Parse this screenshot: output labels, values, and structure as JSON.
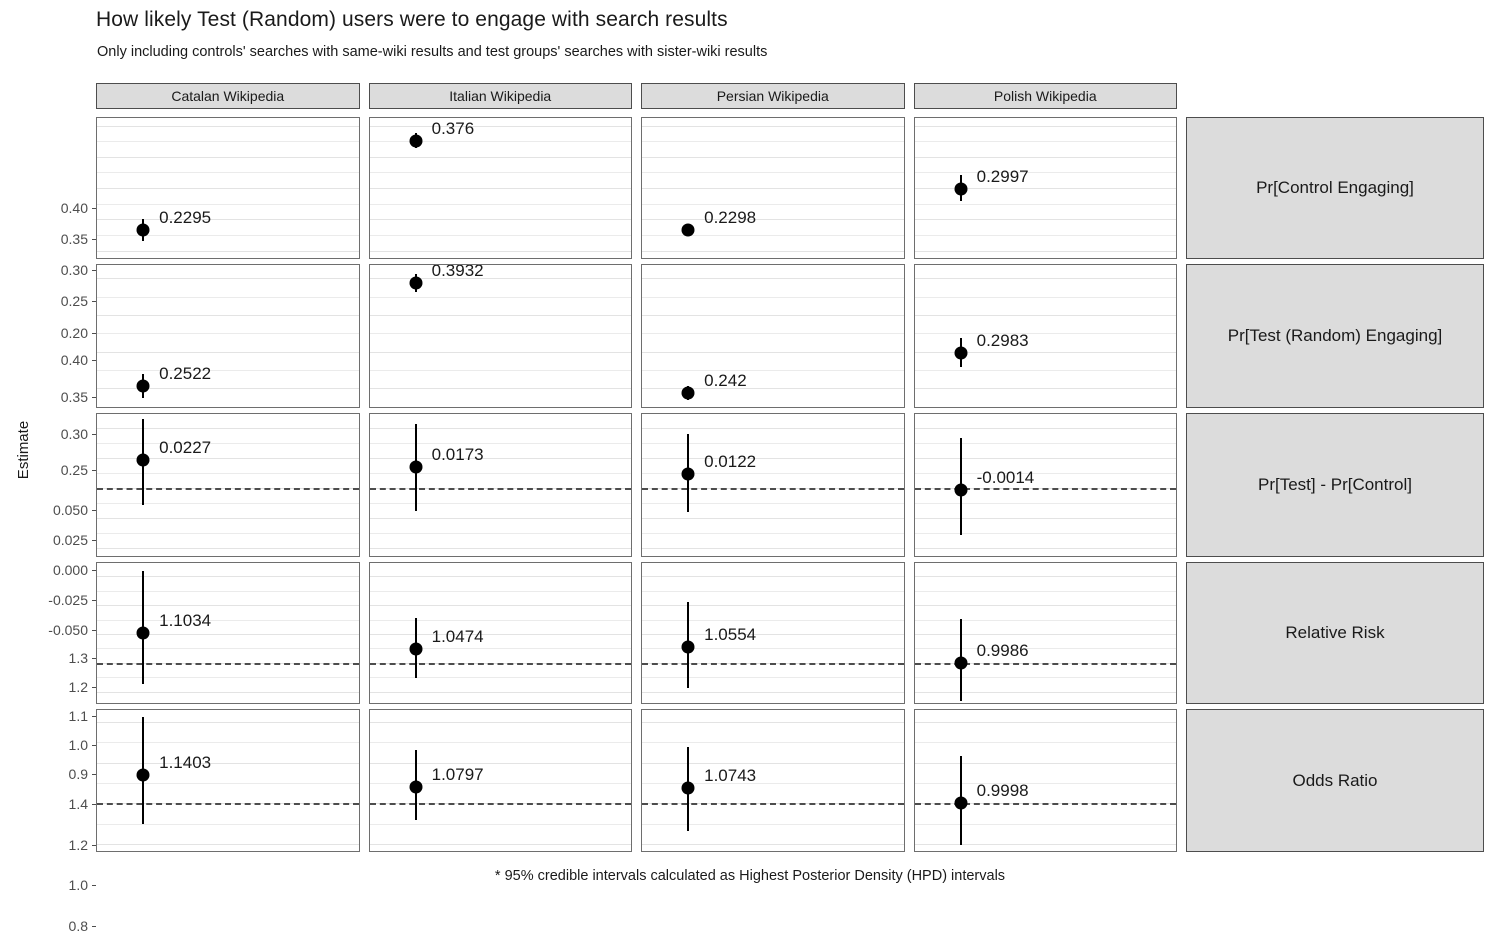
{
  "header": {
    "title": "How likely Test (Random) users were to engage with search results",
    "subtitle": "Only including controls' searches with same-wiki results and test groups' searches with sister-wiki results",
    "caption": "* 95% credible intervals calculated as Highest Posterior Density (HPD) intervals"
  },
  "axis": {
    "y_title": "Estimate"
  },
  "colors": {
    "strip_fill": "#dcdcdc",
    "strip_border": "#4d4d4d",
    "panel_border": "#6e6e6e",
    "gridline": "#ebebeb",
    "point": "#000000",
    "refline": "#4d4d4d",
    "background": "#ffffff"
  },
  "chart_data": {
    "type": "scatter",
    "title": "How likely Test (Random) users were to engage with search results",
    "subtitle": "Only including controls' searches with same-wiki results and test groups' searches with sister-wiki results",
    "caption": "* 95% credible intervals calculated as Highest Posterior Density (HPD) intervals",
    "ylabel": "Estimate",
    "xlabel": "",
    "grid": true,
    "legend": "none",
    "facet_columns": [
      "Catalan Wikipedia",
      "Italian Wikipedia",
      "Persian Wikipedia",
      "Polish Wikipedia"
    ],
    "facet_rows": [
      "Pr[Control Engaging]",
      "Pr[Test (Random) Engaging]",
      "Pr[Test] - Pr[Control]",
      "Relative Risk",
      "Odds Ratio"
    ],
    "rows": [
      {
        "label": "Pr[Control Engaging]",
        "ylim": [
          0.185,
          0.412
        ],
        "yticks": [
          0.4,
          0.35,
          0.3,
          0.25,
          0.2
        ],
        "ytick_labels": [
          "0.40",
          "0.35",
          "0.30",
          "0.25",
          "0.20"
        ],
        "refline": null,
        "points": [
          {
            "facet": "Catalan Wikipedia",
            "label": "0.2295",
            "estimate": 0.2326,
            "lower": 0.2155,
            "upper": 0.2505
          },
          {
            "facet": "Italian Wikipedia",
            "label": "0.376",
            "estimate": 0.3757,
            "lower": 0.3635,
            "upper": 0.3888
          },
          {
            "facet": "Persian Wikipedia",
            "label": "0.2298",
            "estimate": 0.2322,
            "lower": 0.2236,
            "upper": 0.2415
          },
          {
            "facet": "Polish Wikipedia",
            "label": "0.2997",
            "estimate": 0.299,
            "lower": 0.2792,
            "upper": 0.3212
          }
        ]
      },
      {
        "label": "Pr[Test (Random) Engaging]",
        "ylim": [
          0.222,
          0.418
        ],
        "yticks": [
          0.4,
          0.35,
          0.3,
          0.25
        ],
        "ytick_labels": [
          "0.40",
          "0.35",
          "0.30",
          "0.25"
        ],
        "refline": null,
        "points": [
          {
            "facet": "Catalan Wikipedia",
            "label": "0.2522",
            "estimate": 0.2529,
            "lower": 0.2365,
            "upper": 0.27
          },
          {
            "facet": "Italian Wikipedia",
            "label": "0.3932",
            "estimate": 0.3934,
            "lower": 0.381,
            "upper": 0.406
          },
          {
            "facet": "Persian Wikipedia",
            "label": "0.242",
            "estimate": 0.2437,
            "lower": 0.234,
            "upper": 0.2534
          },
          {
            "facet": "Polish Wikipedia",
            "label": "0.2983",
            "estimate": 0.2985,
            "lower": 0.279,
            "upper": 0.3192
          }
        ]
      },
      {
        "label": "Pr[Test] - Pr[Control]",
        "ylim": [
          -0.058,
          0.062
        ],
        "yticks": [
          0.05,
          0.025,
          0.0,
          -0.025,
          -0.05
        ],
        "ytick_labels": [
          "0.050",
          "0.025",
          "0.000",
          "-0.025",
          "-0.050"
        ],
        "refline": 0.0,
        "points": [
          {
            "facet": "Catalan Wikipedia",
            "label": "0.0227",
            "estimate": 0.0235,
            "lower": -0.0136,
            "upper": 0.0582
          },
          {
            "facet": "Italian Wikipedia",
            "label": "0.0173",
            "estimate": 0.018,
            "lower": -0.019,
            "upper": 0.054
          },
          {
            "facet": "Persian Wikipedia",
            "label": "0.0122",
            "estimate": 0.012,
            "lower": -0.02,
            "upper": 0.045
          },
          {
            "facet": "Polish Wikipedia",
            "label": "-0.0014",
            "estimate": -0.0014,
            "lower": -0.0392,
            "upper": 0.042
          }
        ]
      },
      {
        "label": "Relative Risk",
        "ylim": [
          0.855,
          1.345
        ],
        "yticks": [
          1.3,
          1.2,
          1.1,
          1.0,
          0.9
        ],
        "ytick_labels": [
          "1.3",
          "1.2",
          "1.1",
          "1.0",
          "0.9"
        ],
        "refline": 1.0,
        "points": [
          {
            "facet": "Catalan Wikipedia",
            "label": "1.1034",
            "estimate": 1.104,
            "lower": 0.929,
            "upper": 1.319
          },
          {
            "facet": "Italian Wikipedia",
            "label": "1.0474",
            "estimate": 1.048,
            "lower": 0.949,
            "upper": 1.154
          },
          {
            "facet": "Persian Wikipedia",
            "label": "1.0554",
            "estimate": 1.055,
            "lower": 0.913,
            "upper": 1.212
          },
          {
            "facet": "Polish Wikipedia",
            "label": "0.9986",
            "estimate": 0.999,
            "lower": 0.87,
            "upper": 1.151
          }
        ]
      },
      {
        "label": "Odds Ratio",
        "ylim": [
          0.755,
          1.46
        ],
        "yticks": [
          1.4,
          1.2,
          1.0,
          0.8
        ],
        "ytick_labels": [
          "1.4",
          "1.2",
          "1.0",
          "0.8"
        ],
        "refline": 1.0,
        "points": [
          {
            "facet": "Catalan Wikipedia",
            "label": "1.1403",
            "estimate": 1.14,
            "lower": 0.898,
            "upper": 1.424
          },
          {
            "facet": "Italian Wikipedia",
            "label": "1.0797",
            "estimate": 1.08,
            "lower": 0.918,
            "upper": 1.262
          },
          {
            "facet": "Persian Wikipedia",
            "label": "1.0743",
            "estimate": 1.074,
            "lower": 0.864,
            "upper": 1.28
          },
          {
            "facet": "Polish Wikipedia",
            "label": "0.9998",
            "estimate": 1.0,
            "lower": 0.795,
            "upper": 1.235
          }
        ]
      }
    ]
  }
}
